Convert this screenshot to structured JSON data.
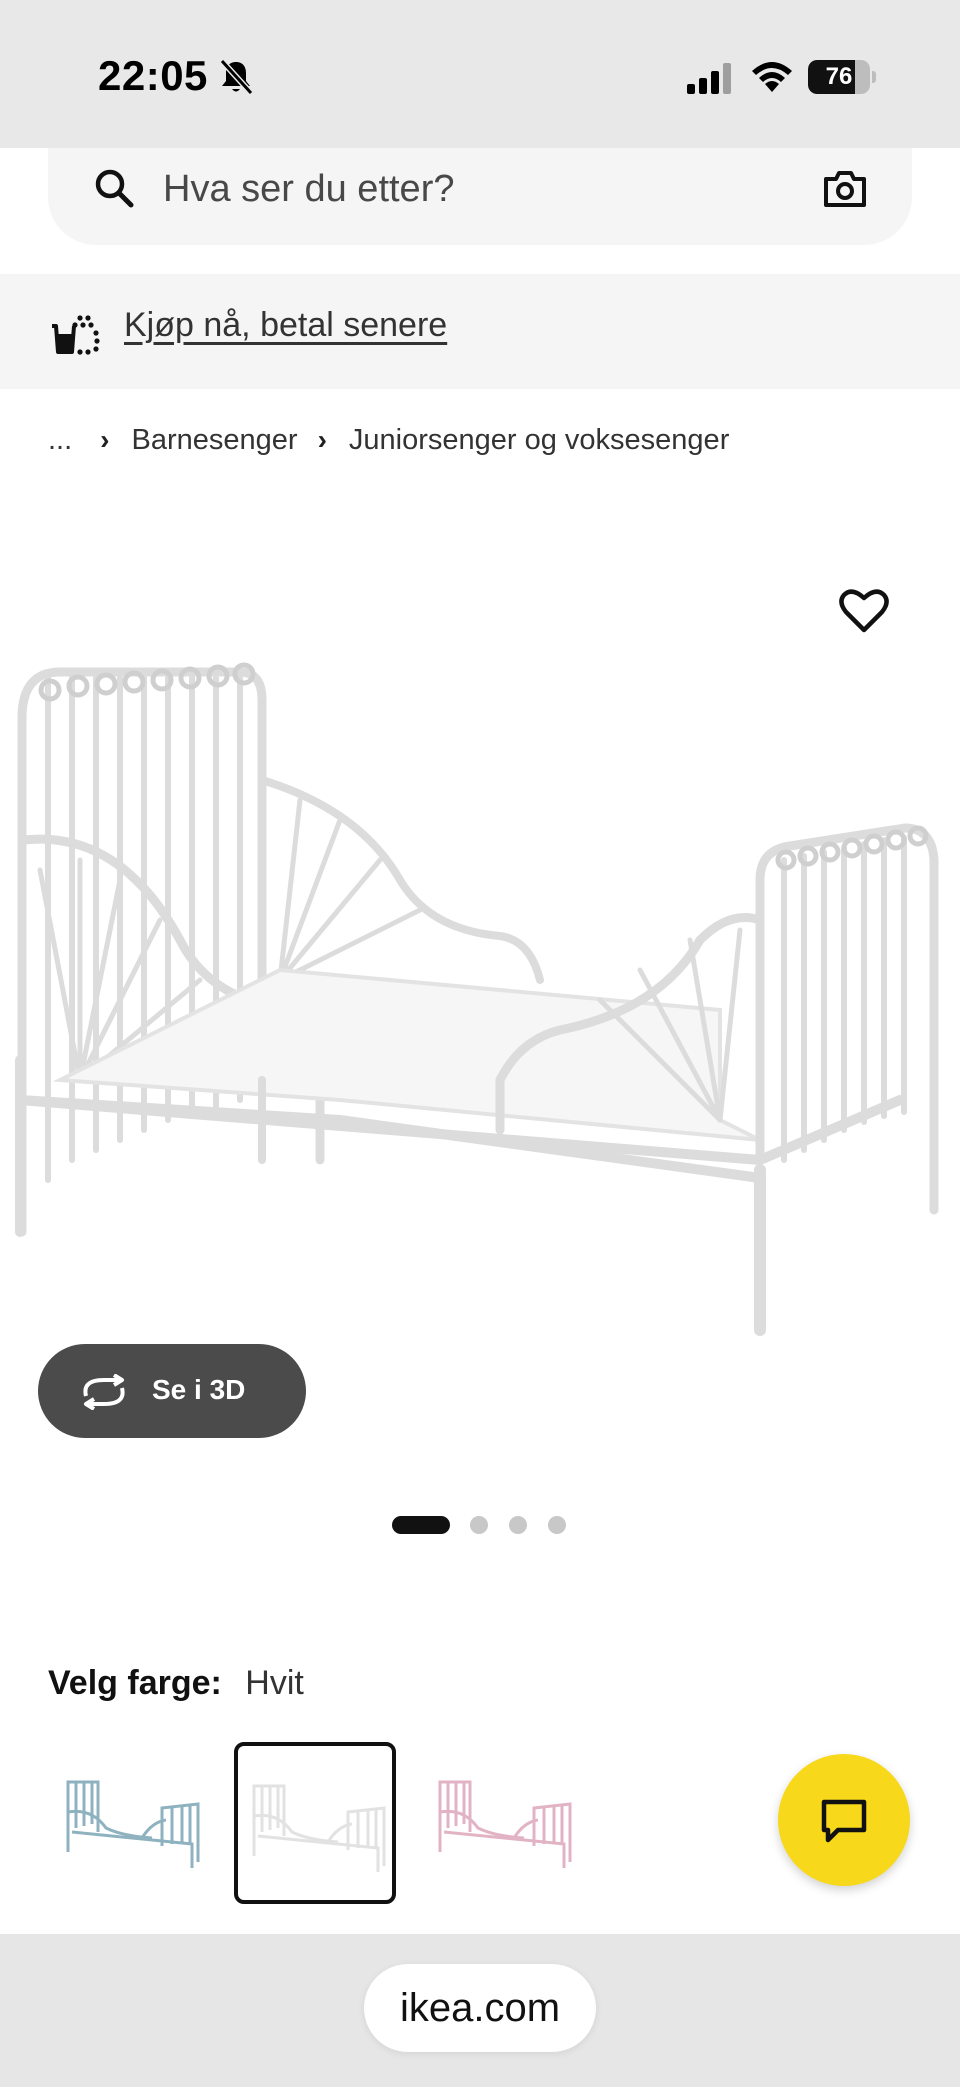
{
  "status_bar": {
    "time": "22:05",
    "battery_percent": 76,
    "battery_label": "76",
    "silent_mode": true
  },
  "search": {
    "placeholder": "Hva ser du etter?"
  },
  "banner": {
    "link_text": "Kjøp nå, betal senere"
  },
  "breadcrumb": {
    "ellipsis": "...",
    "items": [
      "Barnesenger",
      "Juniorsenger og voksesenger"
    ]
  },
  "gallery": {
    "view_3d_label": "Se i 3D",
    "slides_total": 4,
    "active_slide": 1
  },
  "color_picker": {
    "label": "Velg farge:",
    "selected_value": "Hvit",
    "swatch_colors": [
      "#8fb2c0",
      "#ececec",
      "#e2b3c4"
    ]
  },
  "browser": {
    "url": "ikea.com"
  },
  "colors": {
    "chat_button": "#f7d81a",
    "view_3d_button": "#4b4b4b"
  }
}
